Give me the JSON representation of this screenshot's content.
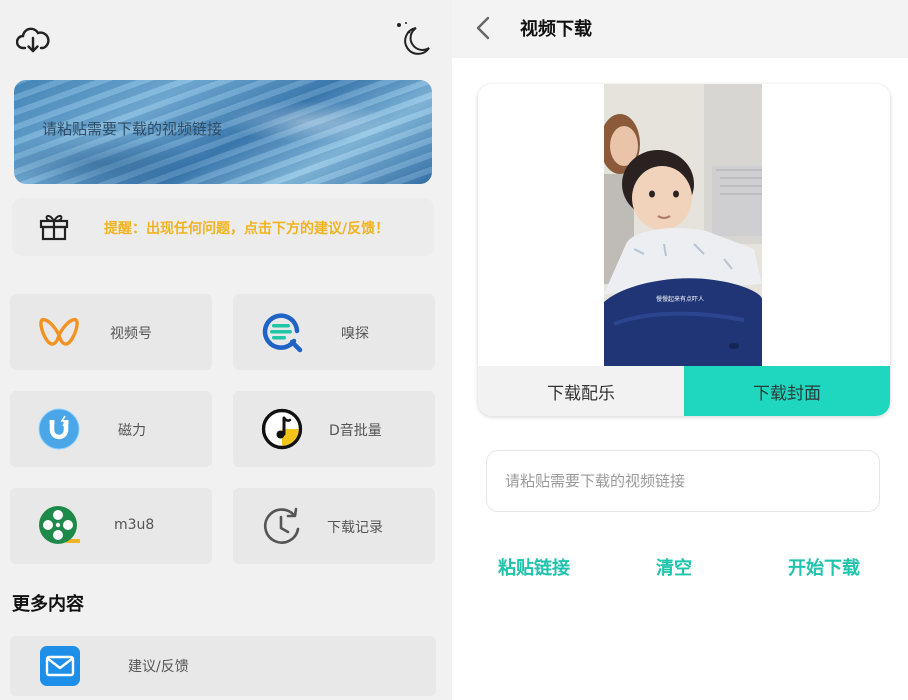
{
  "left": {
    "icons": {
      "cloud": "cloud-download-icon",
      "theme": "moon-icon"
    },
    "banner": {
      "placeholder": "请粘贴需要下载的视频链接"
    },
    "tip": {
      "text": "提醒：出现任何问题，点击下方的建议/反馈！",
      "color": "#f1b320"
    },
    "tiles": [
      {
        "label": "视频号",
        "icon": "butterfly-icon"
      },
      {
        "label": "嗅探",
        "icon": "sniff-search-icon"
      },
      {
        "label": "磁力",
        "icon": "magnet-icon"
      },
      {
        "label": "D音批量",
        "icon": "music-note-icon"
      },
      {
        "label": "m3u8",
        "icon": "film-reel-icon"
      },
      {
        "label": "下载记录",
        "icon": "history-clock-icon"
      }
    ],
    "section_title": "更多内容",
    "feedback": {
      "label": "建议/反馈",
      "icon": "mail-icon"
    }
  },
  "right": {
    "title": "视频下载",
    "preview": {
      "caption": "慢慢起来有点吓人"
    },
    "buttons": {
      "music": "下载配乐",
      "cover": "下载封面"
    },
    "url": {
      "placeholder": "请粘贴需要下载的视频链接",
      "value": ""
    },
    "actions": {
      "paste": "粘贴链接",
      "clear": "清空",
      "start": "开始下载"
    },
    "accent": "#1fd6bf"
  }
}
